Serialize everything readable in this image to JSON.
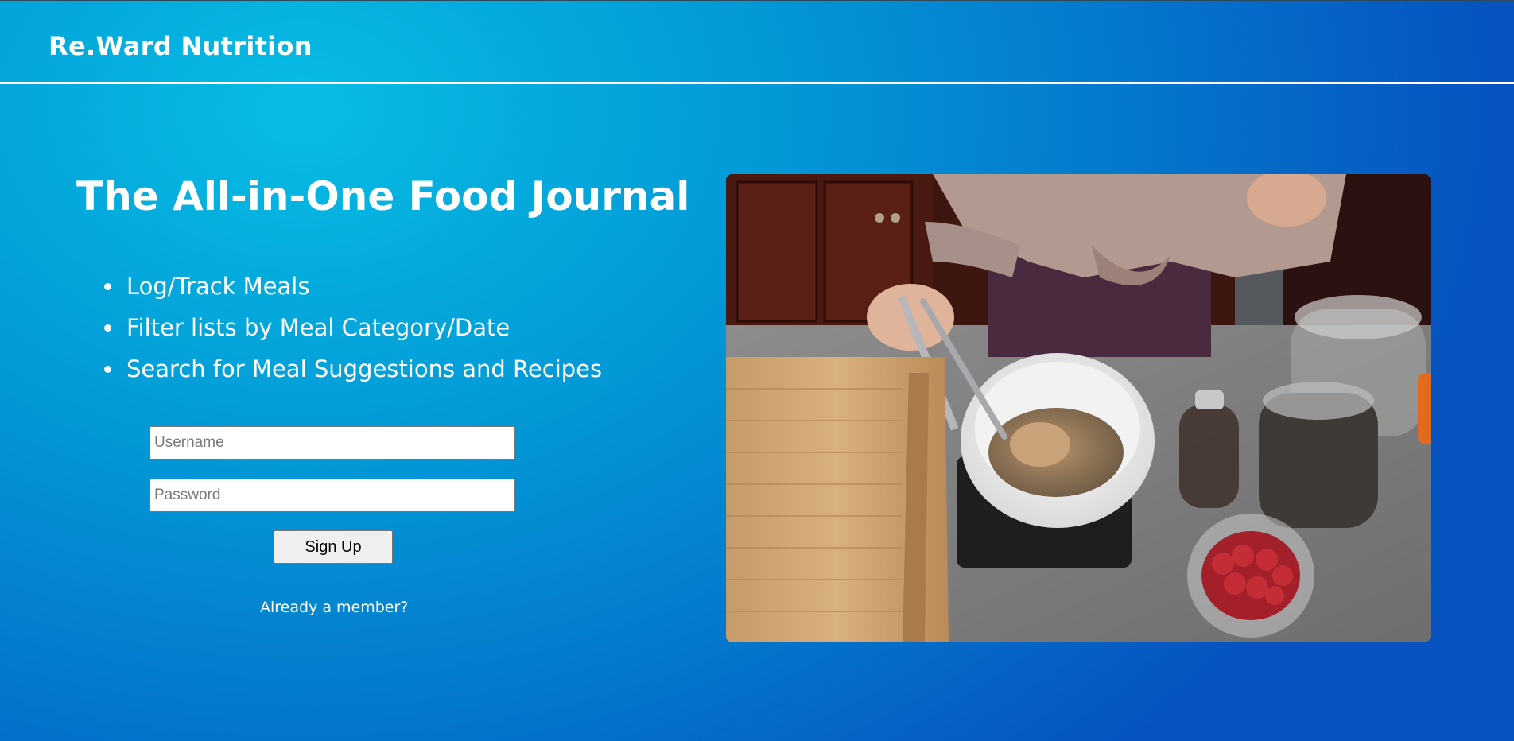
{
  "header": {
    "brand": "Re.Ward Nutrition"
  },
  "hero": {
    "title": "The All-in-One Food Journal",
    "features": [
      "Log/Track Meals",
      "Filter lists by Meal Category/Date",
      "Search for Meal Suggestions and Recipes"
    ]
  },
  "signup_form": {
    "username_placeholder": "Username",
    "password_placeholder": "Password",
    "submit_label": "Sign Up",
    "login_link": "Already a member?"
  },
  "colors": {
    "background_light": "#06bde4",
    "background_dark": "#0653bf",
    "text": "#ffffff"
  }
}
